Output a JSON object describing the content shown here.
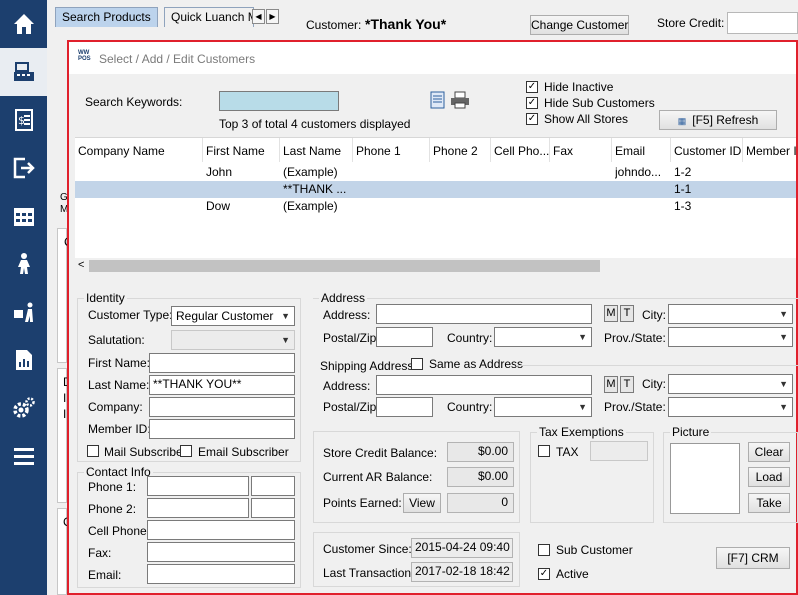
{
  "nav": {
    "items": [
      {
        "name": "home-icon"
      },
      {
        "name": "register-icon"
      },
      {
        "name": "receipt-icon"
      },
      {
        "name": "logout-icon"
      },
      {
        "name": "calendar-icon"
      },
      {
        "name": "delivery-icon"
      },
      {
        "name": "receiving-icon"
      },
      {
        "name": "report-icon"
      },
      {
        "name": "settings-icon"
      },
      {
        "name": "menu-icon"
      }
    ]
  },
  "topbar": {
    "tab_search": "Search Products",
    "tab_quick": "Quick Luanch M",
    "customer_label": "Customer:",
    "customer_value": "*Thank You*",
    "change_customer": "Change Customer",
    "store_credit_label": "Store Credit:"
  },
  "background": {
    "letter_c1": "C",
    "letter_g": "G",
    "letter_m": "M",
    "letter_d": "D",
    "letter_i1": "I",
    "letter_i2": "I",
    "letter_c2": "C"
  },
  "dialog": {
    "logo_top": "WW",
    "logo_bottom": "POS",
    "title": "Select / Add / Edit Customers",
    "search_label": "Search Keywords:",
    "search_value": "",
    "count_text": "Top 3 of total 4 customers displayed",
    "hide_inactive": "Hide Inactive",
    "hide_sub": "Hide Sub Customers",
    "show_all_stores": "Show All Stores",
    "refresh": "[F5] Refresh",
    "columns": [
      "Company Name",
      "First Name",
      "Last Name",
      "Phone 1",
      "Phone 2",
      "Cell Pho...",
      "Fax",
      "Email",
      "Customer ID",
      "Member ID"
    ],
    "rows": [
      {
        "company": "",
        "first": "John",
        "last": "(Example)",
        "phone1": "",
        "phone2": "",
        "cell": "",
        "fax": "",
        "email": "johndo...",
        "id": "1-2",
        "member": ""
      },
      {
        "company": "",
        "first": "",
        "last": "**THANK ...",
        "phone1": "",
        "phone2": "",
        "cell": "",
        "fax": "",
        "email": "",
        "id": "1-1",
        "member": ""
      },
      {
        "company": "",
        "first": "Dow",
        "last": "(Example)",
        "phone1": "",
        "phone2": "",
        "cell": "",
        "fax": "",
        "email": "",
        "id": "1-3",
        "member": ""
      }
    ],
    "scroll_left": "<",
    "identity": {
      "title": "Identity",
      "customer_type_label": "Customer Type:",
      "customer_type_value": "Regular Customer",
      "salutation_label": "Salutation:",
      "first_name_label": "First Name:",
      "last_name_label": "Last Name:",
      "last_name_value": "**THANK YOU**",
      "company_label": "Company:",
      "member_id_label": "Member ID:",
      "mail_subscriber": "Mail Subscriber",
      "email_subscriber": "Email Subscriber"
    },
    "contact": {
      "title": "Contact Info",
      "phone1_label": "Phone 1:",
      "phone2_label": "Phone 2:",
      "cell_label": "Cell Phone:",
      "fax_label": "Fax:",
      "email_label": "Email:"
    },
    "address": {
      "title": "Address",
      "address_label": "Address:",
      "postal_label": "Postal/Zip:",
      "country_label": "Country:",
      "city_label": "City:",
      "prov_label": "Prov./State:",
      "m": "M",
      "t": "T"
    },
    "shipping": {
      "title": "Shipping Address",
      "same_as": "Same as Address",
      "address_label": "Address:",
      "postal_label": "Postal/Zip:",
      "country_label": "Country:",
      "city_label": "City:",
      "prov_label": "Prov./State:",
      "m": "M",
      "t": "T"
    },
    "balances": {
      "store_credit_label": "Store Credit Balance:",
      "store_credit_value": "$0.00",
      "ar_label": "Current AR Balance:",
      "ar_value": "$0.00",
      "points_label": "Points Earned:",
      "view": "View",
      "points_value": "0"
    },
    "tax": {
      "title": "Tax Exemptions",
      "tax_label": "TAX"
    },
    "picture": {
      "title": "Picture",
      "clear": "Clear",
      "load": "Load",
      "take": "Take"
    },
    "dates": {
      "since_label": "Customer Since:",
      "since_value": "2015-04-24  09:40",
      "last_label": "Last Transaction:",
      "last_value": "2017-02-18  18:42"
    },
    "sub_customer": "Sub Customer",
    "active": "Active",
    "crm": "[F7] CRM"
  },
  "colors": {
    "nav_bg": "#1c3f6e",
    "dialog_border": "#e0202c",
    "selected_row": "#c2d4e8",
    "search_box": "#b8dce8"
  }
}
